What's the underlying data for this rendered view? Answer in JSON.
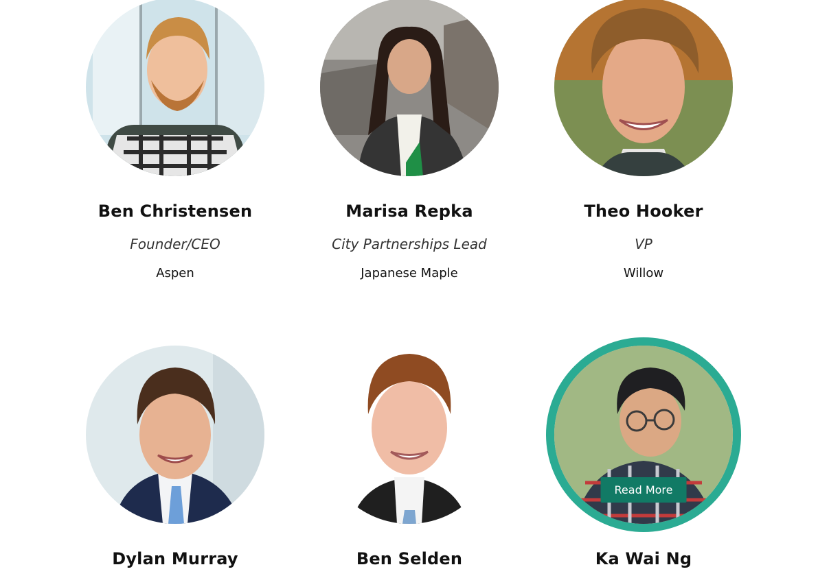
{
  "members": [
    {
      "name": "Ben Christensen",
      "role": "Founder/CEO",
      "tree": "Aspen",
      "avatar_icon": "person-photo"
    },
    {
      "name": "Marisa Repka",
      "role": "City Partnerships Lead",
      "tree": "Japanese Maple",
      "avatar_icon": "person-photo"
    },
    {
      "name": "Theo Hooker",
      "role": "VP",
      "tree": "Willow",
      "avatar_icon": "person-photo"
    },
    {
      "name": "Dylan Murray",
      "avatar_icon": "person-photo"
    },
    {
      "name": "Ben Selden",
      "avatar_icon": "person-photo"
    },
    {
      "name": "Ka Wai Ng",
      "avatar_icon": "person-photo",
      "read_more_label": "Read More"
    }
  ],
  "colors": {
    "highlight_ring": "#2bab93",
    "button_bg": "#117a65",
    "text": "#111111"
  }
}
